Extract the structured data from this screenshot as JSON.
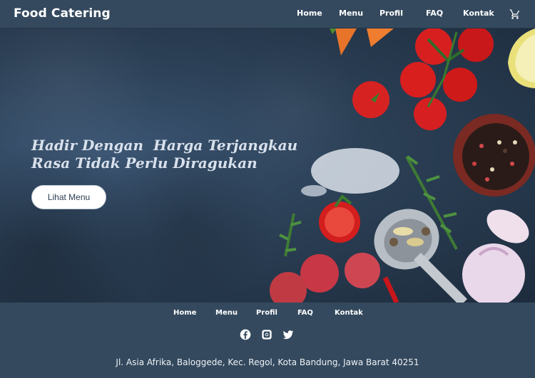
{
  "header": {
    "brand": "Food Catering",
    "nav": [
      "Home",
      "Menu",
      "Profil",
      "FAQ",
      "Kontak"
    ],
    "cart_icon": "cart-icon"
  },
  "hero": {
    "line1": "Hadir Dengan  Harga Terjangkau",
    "line2": "Rasa Tidak Perlu Diragukan",
    "button": "Lihat Menu"
  },
  "footer": {
    "nav": [
      "Home",
      "Menu",
      "Profil",
      "FAQ",
      "Kontak"
    ],
    "social": [
      "facebook-icon",
      "instagram-icon",
      "twitter-icon"
    ],
    "address": "Jl. Asia Afrika, Baloggede, Kec. Regol, Kota Bandung, Jawa Barat 40251"
  },
  "colors": {
    "bar": "#34495e",
    "hero_bg": "#2b3f55",
    "tomato": "#d81f1f"
  }
}
